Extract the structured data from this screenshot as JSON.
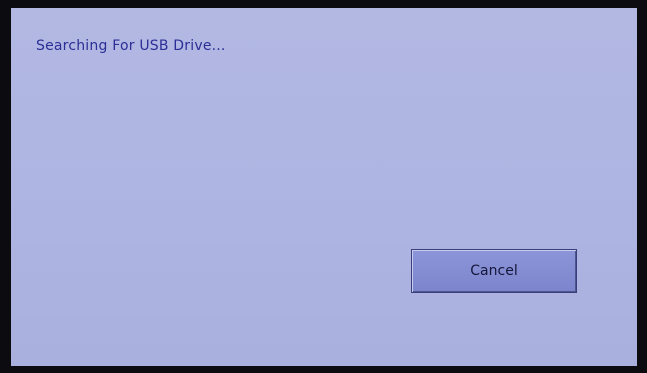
{
  "dialog": {
    "status_text": "Searching For USB Drive...",
    "cancel_label": "Cancel"
  },
  "colors": {
    "screen_background": "#aeb5e2",
    "status_text": "#2b2f96",
    "button_background": "#848dd2",
    "frame": "#0c0c10"
  }
}
